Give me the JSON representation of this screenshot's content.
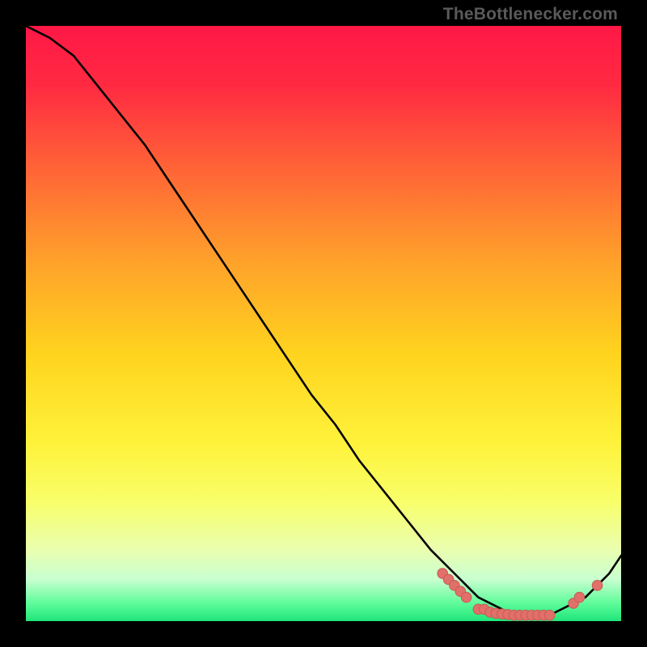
{
  "watermark": "TheBottlenecker.com",
  "colors": {
    "bg": "#000000",
    "curve": "#000000",
    "dot_fill": "#e2706a",
    "dot_stroke": "#c95c56",
    "gradient_stops": [
      {
        "offset": 0.0,
        "color": "#ff1846"
      },
      {
        "offset": 0.1,
        "color": "#ff2a42"
      },
      {
        "offset": 0.25,
        "color": "#ff6836"
      },
      {
        "offset": 0.4,
        "color": "#ffa32a"
      },
      {
        "offset": 0.55,
        "color": "#ffd31e"
      },
      {
        "offset": 0.7,
        "color": "#fff23a"
      },
      {
        "offset": 0.8,
        "color": "#f8ff6a"
      },
      {
        "offset": 0.88,
        "color": "#eaffb0"
      },
      {
        "offset": 0.93,
        "color": "#c8ffd0"
      },
      {
        "offset": 0.97,
        "color": "#5efc9a"
      },
      {
        "offset": 1.0,
        "color": "#1fe57a"
      }
    ]
  },
  "chart_data": {
    "type": "line",
    "title": "",
    "xlabel": "",
    "ylabel": "",
    "xlim": [
      0,
      100
    ],
    "ylim": [
      0,
      100
    ],
    "series": [
      {
        "name": "bottleneck-curve",
        "x": [
          0,
          4,
          8,
          12,
          16,
          20,
          24,
          28,
          32,
          36,
          40,
          44,
          48,
          52,
          56,
          60,
          64,
          68,
          72,
          74,
          76,
          78,
          80,
          82,
          84,
          86,
          88,
          90,
          92,
          94,
          96,
          98,
          100
        ],
        "y": [
          100,
          98,
          95,
          90,
          85,
          80,
          74,
          68,
          62,
          56,
          50,
          44,
          38,
          33,
          27,
          22,
          17,
          12,
          8,
          6,
          4,
          3,
          2,
          1,
          1,
          1,
          1,
          2,
          3,
          4,
          6,
          8,
          11
        ]
      }
    ],
    "dots": {
      "name": "highlight-dots",
      "points": [
        {
          "x": 70,
          "y": 8
        },
        {
          "x": 71,
          "y": 7
        },
        {
          "x": 72,
          "y": 6
        },
        {
          "x": 73,
          "y": 5
        },
        {
          "x": 74,
          "y": 4
        },
        {
          "x": 76,
          "y": 2
        },
        {
          "x": 77,
          "y": 2
        },
        {
          "x": 78,
          "y": 1.5
        },
        {
          "x": 79,
          "y": 1.3
        },
        {
          "x": 80,
          "y": 1.2
        },
        {
          "x": 81,
          "y": 1.1
        },
        {
          "x": 82,
          "y": 1
        },
        {
          "x": 83,
          "y": 1
        },
        {
          "x": 84,
          "y": 1
        },
        {
          "x": 85,
          "y": 1
        },
        {
          "x": 86,
          "y": 1
        },
        {
          "x": 87,
          "y": 1
        },
        {
          "x": 88,
          "y": 1
        },
        {
          "x": 92,
          "y": 3
        },
        {
          "x": 93,
          "y": 4
        },
        {
          "x": 96,
          "y": 6
        }
      ]
    }
  }
}
